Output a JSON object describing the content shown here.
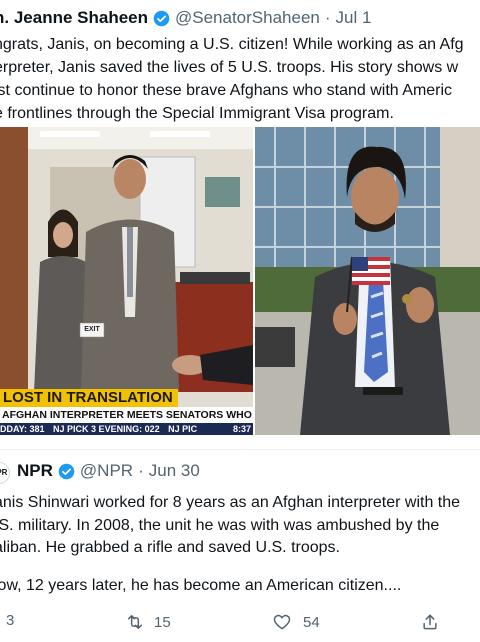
{
  "tweet": {
    "author_name": "n. Jeanne Shaheen",
    "handle": "@SenatorShaheen",
    "separator": "·",
    "date": "Jul 1",
    "text_lines": [
      "ngrats, Janis, on becoming a U.S. citizen! While working as an Afg",
      "erpreter, Janis saved the lives of 5 U.S. troops. His story shows w",
      "ist continue to honor these brave Afghans who stand with Americ",
      "e frontlines through the Special Immigrant Visa program."
    ]
  },
  "media": {
    "lower_third": {
      "title": "LOST IN TRANSLATION",
      "subtitle": "AFGHAN INTERPRETER MEETS SENATORS WHO HELPED HIM",
      "ticker": [
        "DDAY: 381",
        "NJ PICK 3 EVENING: 022",
        "NJ PIC",
        "8:37"
      ]
    },
    "exit_sign": "EXIT"
  },
  "quoted": {
    "avatar_label": "NPR",
    "author_name": "NPR",
    "handle": "@NPR",
    "separator": "·",
    "date": "Jun 30",
    "text_lines": [
      "anis Shinwari worked for 8 years as an Afghan interpreter with the",
      ".S. military. In 2008, the unit he was with was ambushed by the",
      "aliban. He grabbed a rifle and saved U.S. troops.",
      "",
      "low, 12 years later, he has become an American citizen...."
    ]
  },
  "actions": {
    "reply_count": "3",
    "retweet_count": "15",
    "like_count": "54"
  },
  "colors": {
    "verified_blue": "#1d9bf0",
    "muted_gray": "#536471",
    "ticker_navy": "#1b2a55",
    "lower_third_yellow": "#f2c200"
  }
}
